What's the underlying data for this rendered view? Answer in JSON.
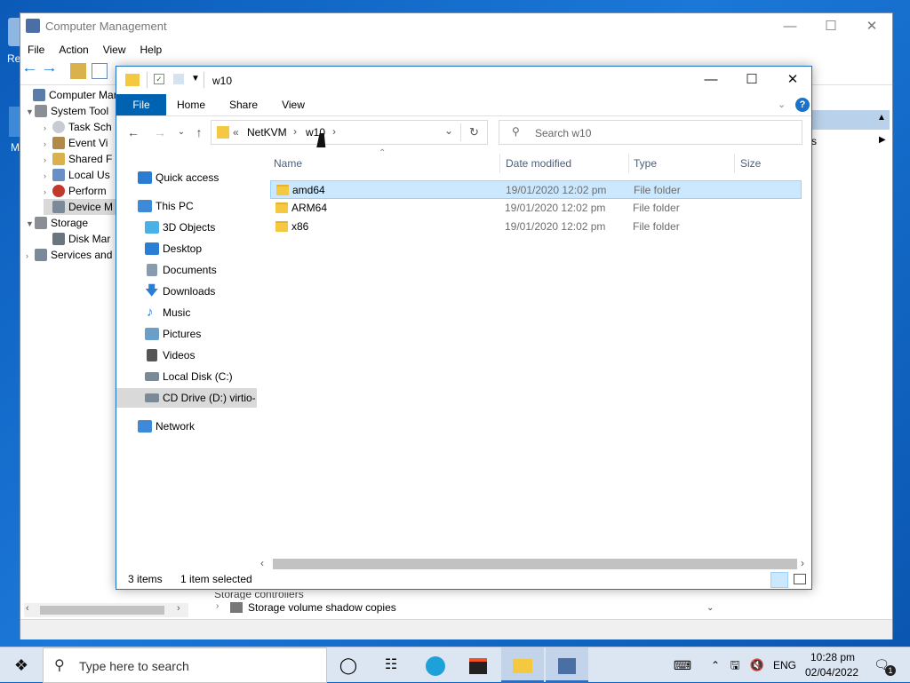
{
  "desktop": {
    "fragment_top": "Re",
    "fragment_mid": "M"
  },
  "computer_management": {
    "title": "Computer Management",
    "menu": [
      "File",
      "Action",
      "View",
      "Help"
    ],
    "tree": [
      {
        "label": "Computer Man",
        "indent": 0,
        "twisty": ""
      },
      {
        "label": "System Tool",
        "indent": 1,
        "twisty": "▼"
      },
      {
        "label": "Task Sch",
        "indent": 2,
        "twisty": "›"
      },
      {
        "label": "Event Vi",
        "indent": 2,
        "twisty": "›"
      },
      {
        "label": "Shared F",
        "indent": 2,
        "twisty": "›"
      },
      {
        "label": "Local Us",
        "indent": 2,
        "twisty": "›"
      },
      {
        "label": "Perform",
        "indent": 2,
        "twisty": "›"
      },
      {
        "label": "Device M",
        "indent": 2,
        "twisty": ""
      },
      {
        "label": "Storage",
        "indent": 1,
        "twisty": "▼"
      },
      {
        "label": "Disk Mar",
        "indent": 2,
        "twisty": ""
      },
      {
        "label": "Services and",
        "indent": 1,
        "twisty": "›"
      }
    ],
    "actions_fragment": "s",
    "bottom_items": [
      "Storage controllers",
      "Storage volume shadow copies"
    ]
  },
  "explorer": {
    "title": "w10",
    "ribbon_tabs": [
      "File",
      "Home",
      "Share",
      "View"
    ],
    "breadcrumb": {
      "prefix": "«",
      "parts": [
        "NetKVM",
        "w10"
      ]
    },
    "search_placeholder": "Search w10",
    "nav": [
      {
        "label": "Quick access",
        "level": 0,
        "icon": "star-icon",
        "color": "#2b7cd3"
      },
      {
        "label": "This PC",
        "level": 0,
        "icon": "computer-icon",
        "color": "#3c8ad8"
      },
      {
        "label": "3D Objects",
        "level": 1,
        "icon": "cube-icon",
        "color": "#4ab0e8"
      },
      {
        "label": "Desktop",
        "level": 1,
        "icon": "desktop-icon",
        "color": "#2a7fd4"
      },
      {
        "label": "Documents",
        "level": 1,
        "icon": "document-icon",
        "color": "#8a9bb0"
      },
      {
        "label": "Downloads",
        "level": 1,
        "icon": "download-icon",
        "color": "#2a7fd4"
      },
      {
        "label": "Music",
        "level": 1,
        "icon": "music-icon",
        "color": "#2a7fd4"
      },
      {
        "label": "Pictures",
        "level": 1,
        "icon": "pictures-icon",
        "color": "#6aa0c8"
      },
      {
        "label": "Videos",
        "level": 1,
        "icon": "video-icon",
        "color": "#555555"
      },
      {
        "label": "Local Disk (C:)",
        "level": 1,
        "icon": "drive-icon",
        "color": "#7a8a99"
      },
      {
        "label": "CD Drive (D:) virtio-",
        "level": 1,
        "icon": "cd-drive-icon",
        "color": "#7a8a99"
      },
      {
        "label": "Network",
        "level": 0,
        "icon": "network-icon",
        "color": "#3c8ad8"
      }
    ],
    "columns": [
      "Name",
      "Date modified",
      "Type",
      "Size"
    ],
    "files": [
      {
        "name": "amd64",
        "date": "19/01/2020 12:02 pm",
        "type": "File folder",
        "size": "",
        "selected": true
      },
      {
        "name": "ARM64",
        "date": "19/01/2020 12:02 pm",
        "type": "File folder",
        "size": "",
        "selected": false
      },
      {
        "name": "x86",
        "date": "19/01/2020 12:02 pm",
        "type": "File folder",
        "size": "",
        "selected": false
      }
    ],
    "status": {
      "count": "3 items",
      "selection": "1 item selected"
    }
  },
  "taskbar": {
    "search_placeholder": "Type here to search",
    "lang": "ENG",
    "time": "10:28 pm",
    "date": "02/04/2022",
    "notification_count": "1"
  },
  "colors": {
    "accent": "#0063b1",
    "selection": "#cce8ff",
    "selection_border": "#99d1ff",
    "help": "#1a73c8"
  }
}
